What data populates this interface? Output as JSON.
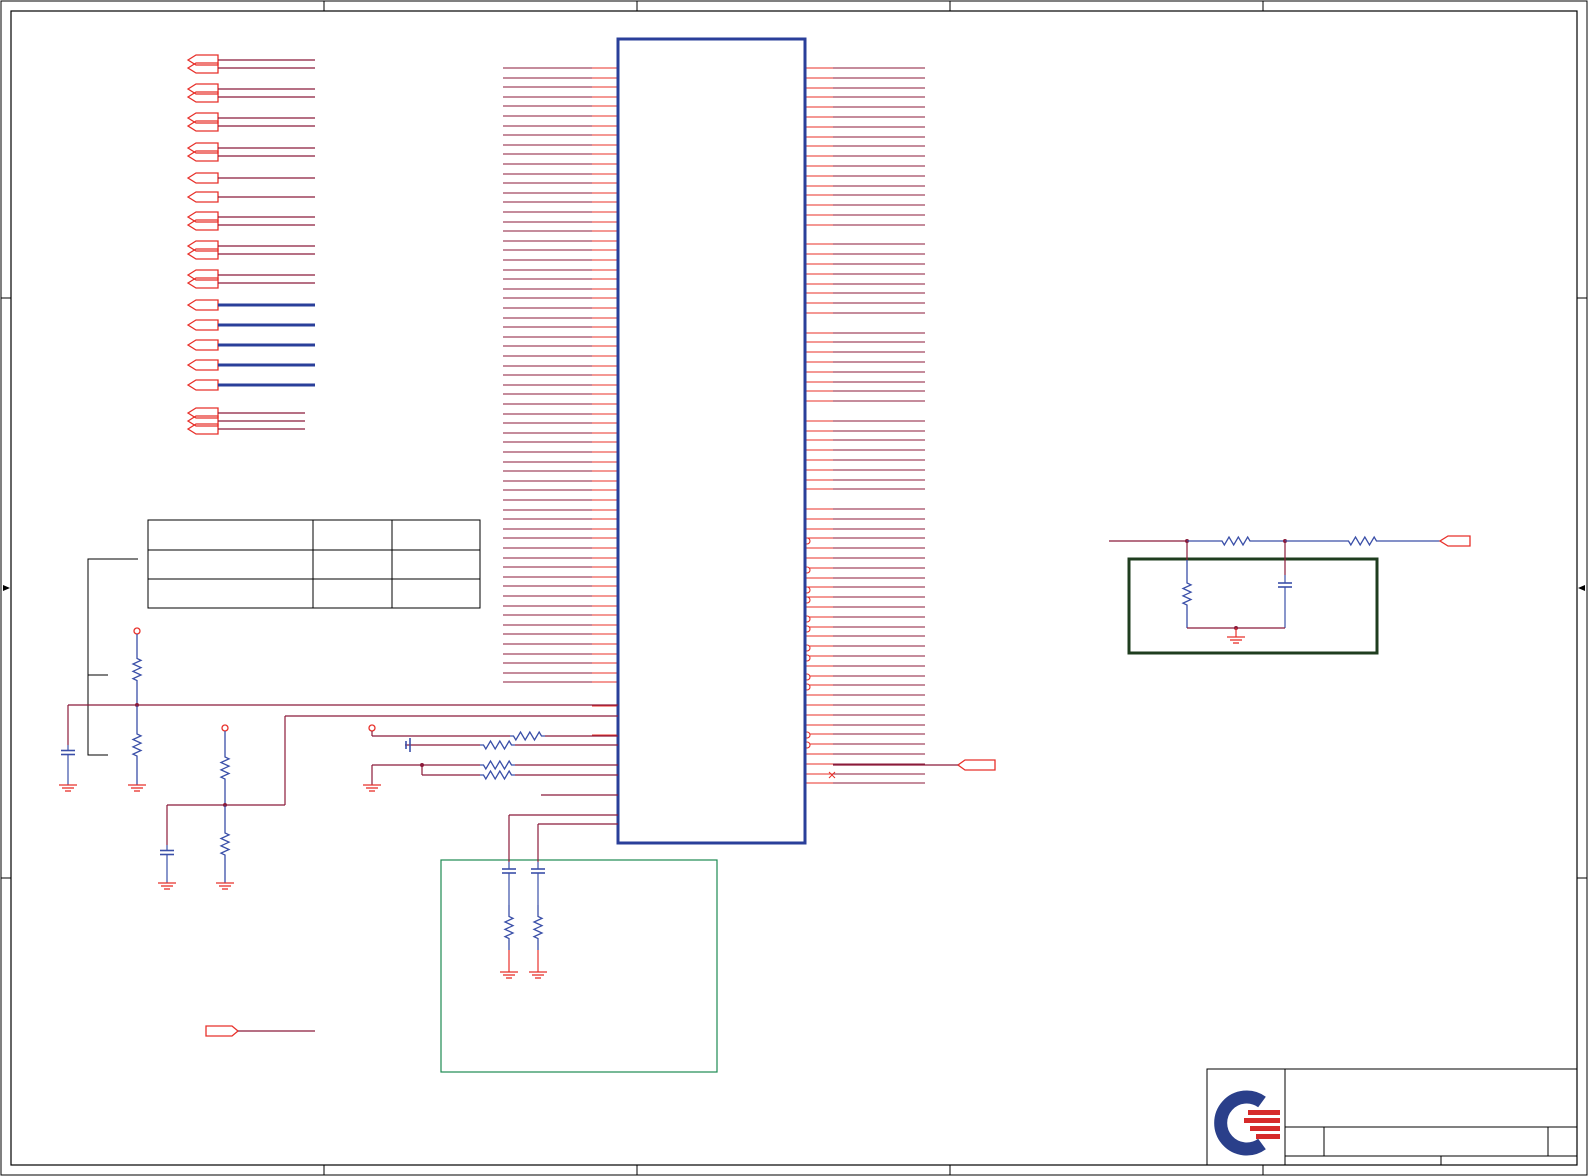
{
  "colors": {
    "border": "#000000",
    "wire": "#8b1a3a",
    "pin": "#e8302a",
    "ic_outline": "#2a3f9a",
    "bus": "#2a3f9a",
    "component": "#3a4fa8",
    "green_box": "#1f3d1f",
    "teal_box": "#1d8a52",
    "logo_blue": "#2a3f8a",
    "logo_red": "#d62a2a",
    "background": "#ffffff"
  },
  "left_connectors": {
    "count_pairs": 7,
    "count_single": 2,
    "count_bus": 5,
    "count_triple": 3
  },
  "ic": {
    "left_pin_count": 66,
    "right_pin_count": 72
  },
  "title_block": {
    "logo": "company-logo-icon"
  }
}
